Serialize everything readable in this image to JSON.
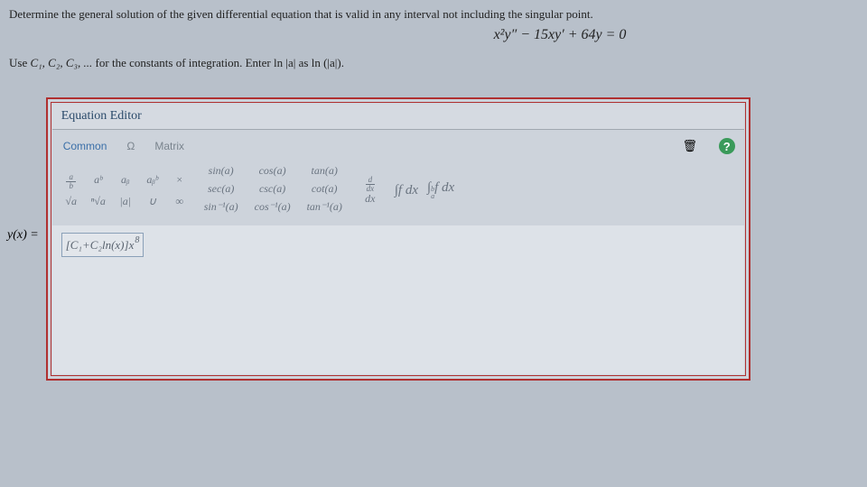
{
  "question": {
    "prompt": "Determine the general solution of the given differential equation that is valid in any interval not including the singular point.",
    "equation": "x²y″ − 15xy′ + 64y = 0",
    "instruction_prefix": "Use ",
    "constants": "C₁, C₂, C₃, ...",
    "instruction_mid": " for the constants of integration. Enter ",
    "ln_abs1": "ln |a|",
    "instruction_as": " as ",
    "ln_abs2": "ln (|a|)",
    "instruction_end": "."
  },
  "answer_label": "y(x) =",
  "editor": {
    "title": "Equation Editor",
    "tabs": {
      "common": "Common",
      "omega": "Ω",
      "matrix": "Matrix"
    },
    "toolbar": {
      "frac": {
        "n": "a",
        "d": "b"
      },
      "pow": "aᵇ",
      "sub": "aᵦ",
      "subsup": "aᵦᵇ",
      "times": "×",
      "sqrt": "√a",
      "nroot": "ⁿ√a",
      "abs": "|a|",
      "union": "∪",
      "inf": "∞",
      "sin": "sin(a)",
      "cos": "cos(a)",
      "tan": "tan(a)",
      "sec": "sec(a)",
      "csc": "csc(a)",
      "cot": "cot(a)",
      "asin": "sin⁻¹(a)",
      "acos": "cos⁻¹(a)",
      "atan": "tan⁻¹(a)",
      "ddx_n": "d",
      "ddx_d": "dx",
      "int1": "∫f dx",
      "int2_pre": "∫",
      "int2_post": "f dx",
      "int2_a": "a",
      "int2_b": "b"
    },
    "entered": {
      "open": "[",
      "c1": "C₁",
      "plus": " + ",
      "c2": "C₂",
      "ln": "ln(x)",
      "close": "]",
      "var": "x",
      "exp": "8"
    }
  }
}
